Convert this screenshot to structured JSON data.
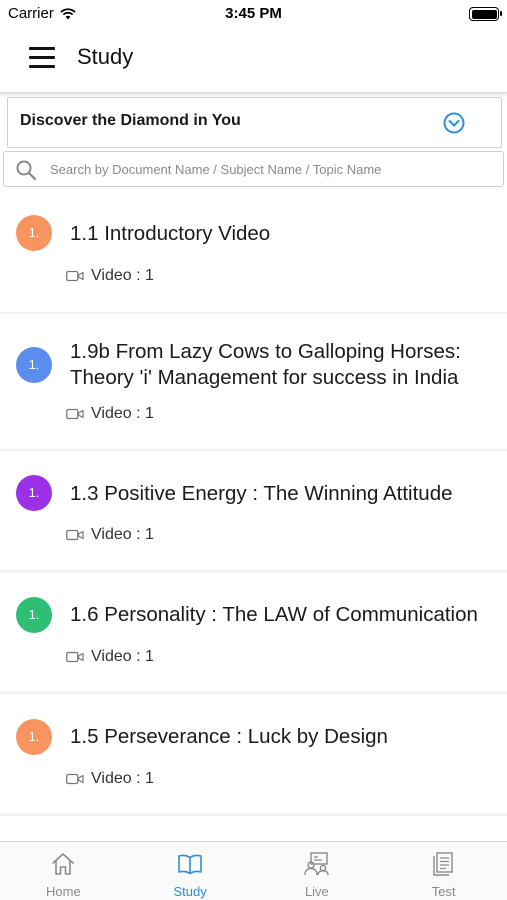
{
  "status_bar": {
    "carrier": "Carrier",
    "time": "3:45 PM"
  },
  "header": {
    "title": "Study"
  },
  "course_select": {
    "selected": "Discover the Diamond in You"
  },
  "search": {
    "placeholder": "Search by Document Name / Subject Name / Topic Name",
    "value": ""
  },
  "items": [
    {
      "badge": "1.",
      "badge_color": "#F7945F",
      "title_lines": [
        "1.1 Introductory Video"
      ],
      "meta": "Video : 1"
    },
    {
      "badge": "1.",
      "badge_color": "#5B8DEF",
      "title_lines": [
        "1.9b From Lazy Cows to Galloping Horses:",
        "Theory 'i' Management for success in India"
      ],
      "meta": "Video : 1"
    },
    {
      "badge": "1.",
      "badge_color": "#9B30E6",
      "title_lines": [
        "1.3 Positive Energy : The Winning Attitude"
      ],
      "meta": "Video : 1"
    },
    {
      "badge": "1.",
      "badge_color": "#2FBE73",
      "title_lines": [
        "1.6 Personality : The LAW of Communication"
      ],
      "meta": "Video : 1"
    },
    {
      "badge": "1.",
      "badge_color": "#F7945F",
      "title_lines": [
        "1.5 Perseverance : Luck by Design"
      ],
      "meta": "Video : 1"
    }
  ],
  "tabbar": {
    "tabs": [
      {
        "label": "Home",
        "icon": "home-icon",
        "active": false
      },
      {
        "label": "Study",
        "icon": "book-icon",
        "active": true
      },
      {
        "label": "Live",
        "icon": "live-class-icon",
        "active": false
      },
      {
        "label": "Test",
        "icon": "test-document-icon",
        "active": false
      }
    ]
  },
  "colors": {
    "accent": "#2B8FD6",
    "inactive": "#8A8A8A"
  }
}
